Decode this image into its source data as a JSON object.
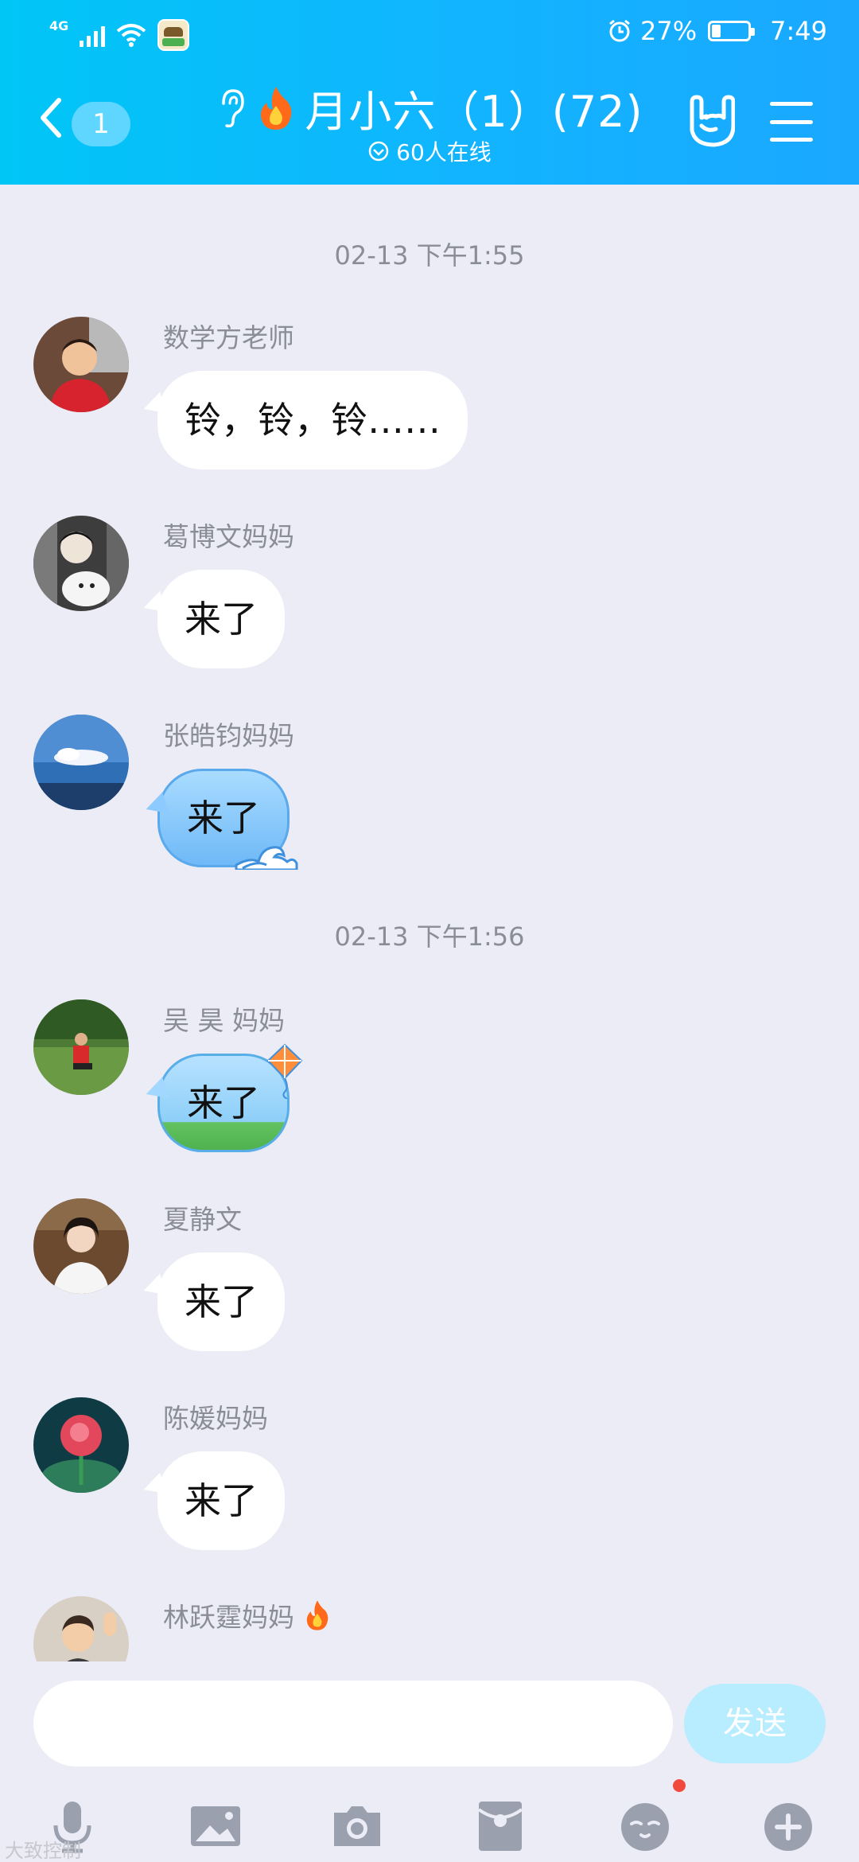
{
  "status_bar": {
    "network": "4G",
    "battery": "27%",
    "time": "7:49"
  },
  "header": {
    "back_badge": "1",
    "title": "月小六（1）(72)",
    "online": "60人在线"
  },
  "messages": [
    {
      "type": "timestamp",
      "text": "02-13 下午1:55"
    },
    {
      "sender": "数学方老师",
      "text": "铃，铃，铃……",
      "bubble": "default"
    },
    {
      "sender": "葛博文妈妈",
      "text": "来了",
      "bubble": "default"
    },
    {
      "sender": "张皓钧妈妈",
      "text": "来了",
      "bubble": "wave"
    },
    {
      "type": "timestamp",
      "text": "02-13 下午1:56"
    },
    {
      "sender": "吴 昊 妈妈",
      "text": "来了",
      "bubble": "kite"
    },
    {
      "sender": "夏静文",
      "text": "来了",
      "bubble": "default"
    },
    {
      "sender": "陈媛妈妈",
      "text": "来了",
      "bubble": "default"
    },
    {
      "sender": "林跃霆妈妈",
      "text": "",
      "bubble": "partial"
    }
  ],
  "input": {
    "placeholder": "",
    "send_label": "发送"
  },
  "toolbar": [
    "mic-icon",
    "image-icon",
    "camera-icon",
    "red-packet-icon",
    "emoji-icon",
    "plus-icon"
  ],
  "watermark": "大致控制"
}
